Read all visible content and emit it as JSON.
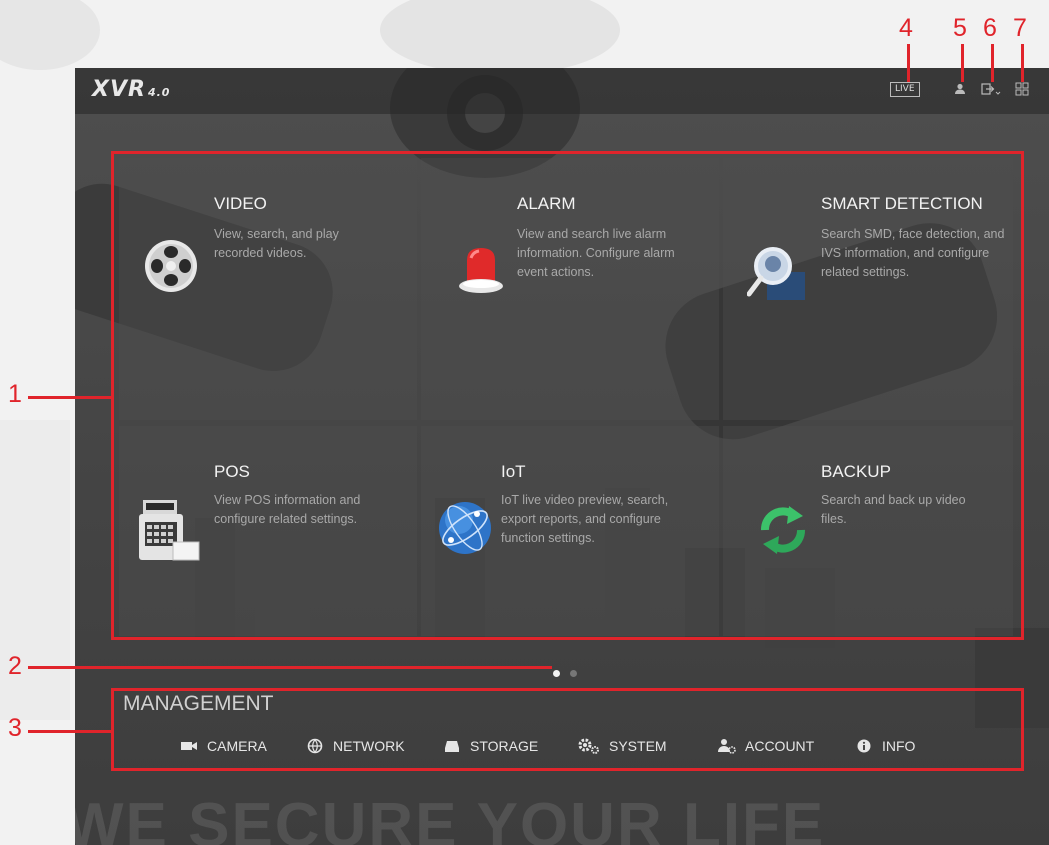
{
  "header": {
    "logo": "XVR",
    "logo_version": "4.0",
    "live_label": "LIVE",
    "icons": [
      "user-icon",
      "logout-icon",
      "grid-menu-icon"
    ]
  },
  "tiles": [
    {
      "title": "VIDEO",
      "desc": "View, search, and play recorded videos.",
      "icon": "video-playback-icon"
    },
    {
      "title": "ALARM",
      "desc": "View and search live alarm information. Configure alarm event actions.",
      "icon": "alarm-siren-icon"
    },
    {
      "title": "SMART DETECTION",
      "desc": "Search SMD, face detection, and IVS information, and configure related settings.",
      "icon": "smart-detection-icon"
    },
    {
      "title": "POS",
      "desc": "View POS information and configure related settings.",
      "icon": "pos-terminal-icon"
    },
    {
      "title": "IoT",
      "desc": "IoT live video preview, search, export reports, and configure function settings.",
      "icon": "iot-globe-icon"
    },
    {
      "title": "BACKUP",
      "desc": "Search and back up video files.",
      "icon": "backup-refresh-icon"
    }
  ],
  "pagination": {
    "pages": 2,
    "current": 1
  },
  "management": {
    "title": "MANAGEMENT",
    "items": [
      {
        "label": "CAMERA",
        "icon": "camera-icon"
      },
      {
        "label": "NETWORK",
        "icon": "network-icon"
      },
      {
        "label": "STORAGE",
        "icon": "storage-icon"
      },
      {
        "label": "SYSTEM",
        "icon": "system-gears-icon"
      },
      {
        "label": "ACCOUNT",
        "icon": "account-icon"
      },
      {
        "label": "INFO",
        "icon": "info-icon"
      }
    ]
  },
  "background_slogan": "WE SECURE YOUR LIFE",
  "callouts": {
    "c1": "1",
    "c2": "2",
    "c3": "3",
    "c4": "4",
    "c5": "5",
    "c6": "6",
    "c7": "7"
  },
  "colors": {
    "annotation_red": "#e0242b",
    "screen_bg": "#474747"
  }
}
